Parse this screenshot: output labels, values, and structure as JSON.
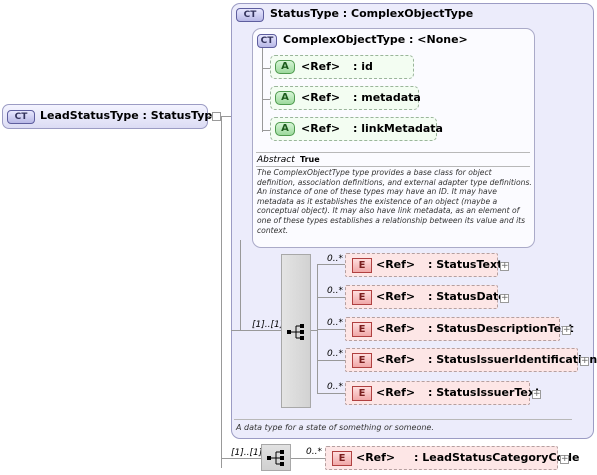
{
  "root": {
    "badge": "CT",
    "label": "LeadStatusType : StatusType"
  },
  "status_type": {
    "badge": "CT",
    "title": "StatusType : ComplexObjectType",
    "description": "A data type for a state of something or someone."
  },
  "complex_object_type": {
    "badge": "CT",
    "title": "ComplexObjectType : <None>",
    "attributes": [
      {
        "badge": "A",
        "ref": "<Ref>",
        "name": ": id"
      },
      {
        "badge": "A",
        "ref": "<Ref>",
        "name": ": metadata"
      },
      {
        "badge": "A",
        "ref": "<Ref>",
        "name": ": linkMetadata"
      }
    ],
    "abstract_label": "Abstract",
    "abstract_value": "True",
    "description": "The ComplexObjectType type provides a base class for object definition, association definitions, and external adapter type definitions. An instance of one of these types may have an ID. It may have metadata as it establishes the existence of an object (maybe a conceptual object). It may also have link metadata, as an element of one of these types establishes a relationship between its value and its context."
  },
  "sequence_multiplicity": "[1]..[1]",
  "elements": [
    {
      "badge": "E",
      "ref": "<Ref>",
      "name": ": StatusText",
      "multiplicity": "0..*"
    },
    {
      "badge": "E",
      "ref": "<Ref>",
      "name": ": StatusDate",
      "multiplicity": "0..*"
    },
    {
      "badge": "E",
      "ref": "<Ref>",
      "name": ": StatusDescriptionText",
      "multiplicity": "0..*"
    },
    {
      "badge": "E",
      "ref": "<Ref>",
      "name": ": StatusIssuerIdentification",
      "multiplicity": "0..*"
    },
    {
      "badge": "E",
      "ref": "<Ref>",
      "name": ": StatusIssuerText",
      "multiplicity": "0..*"
    }
  ],
  "bottom_sequence_multiplicity": "[1]..[1]",
  "bottom_element": {
    "badge": "E",
    "ref": "<Ref>",
    "name": ": LeadStatusCategoryCode",
    "multiplicity": "0..*"
  },
  "icons": {
    "expand": "+",
    "sequence": "sequence-icon"
  }
}
